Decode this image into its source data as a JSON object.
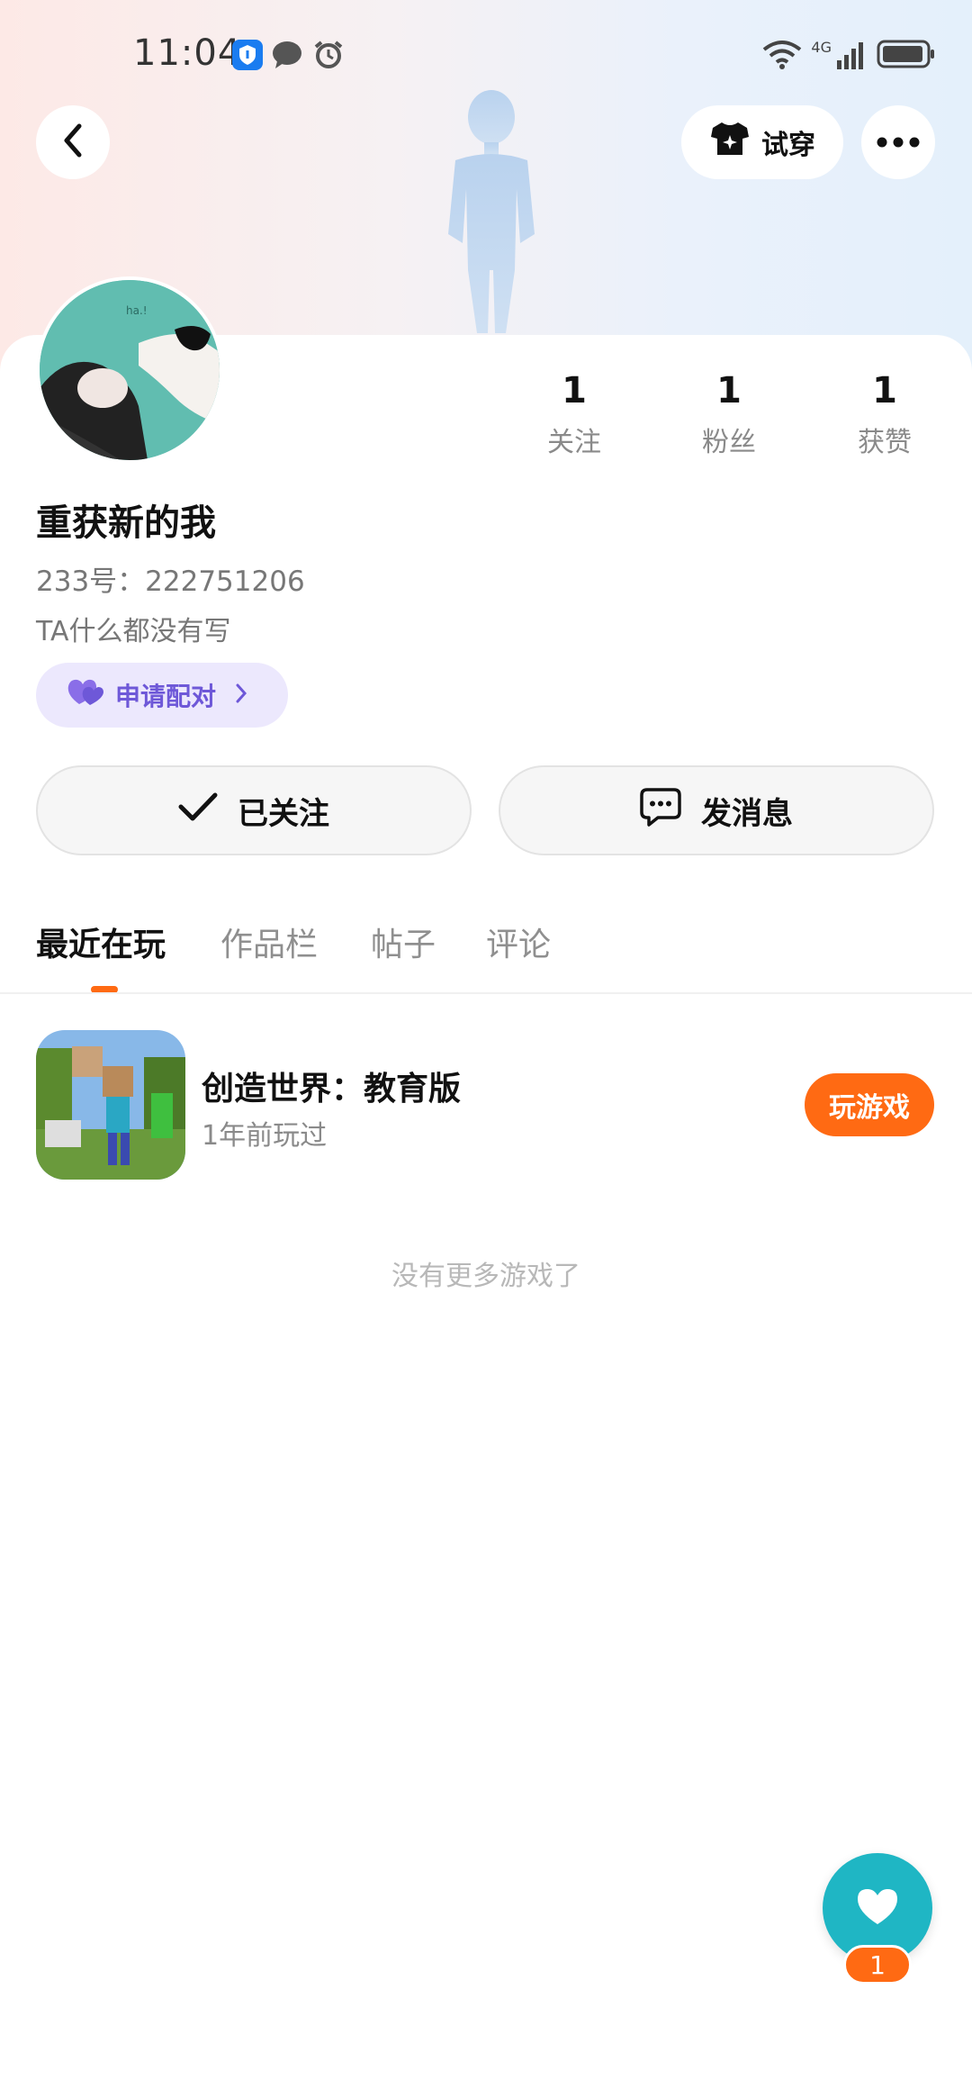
{
  "status_bar": {
    "time": "11:04",
    "icons": [
      "shield-icon",
      "message-bubble-icon",
      "alarm-icon",
      "wifi-icon",
      "signal-icon",
      "battery-icon"
    ],
    "network_label": "4G"
  },
  "header": {
    "back_icon": "chevron-left-icon",
    "tryon_label": "试穿",
    "tryon_icon": "tshirt-sparkle-icon",
    "more_icon": "more-dots-icon"
  },
  "profile": {
    "nickname": "重获新的我",
    "uid": "233号：222751206",
    "bio": "TA什么都没有写",
    "pair_label": "申请配对",
    "stats": [
      {
        "value": "1",
        "label": "关注"
      },
      {
        "value": "1",
        "label": "粉丝"
      },
      {
        "value": "1",
        "label": "获赞"
      }
    ]
  },
  "actions": {
    "follow_label": "已关注",
    "message_label": "发消息"
  },
  "tabs": [
    {
      "label": "最近在玩",
      "active": true
    },
    {
      "label": "作品栏",
      "active": false
    },
    {
      "label": "帖子",
      "active": false
    },
    {
      "label": "评论",
      "active": false
    }
  ],
  "games": [
    {
      "title": "创造世界：教育版",
      "subtitle": "1年前玩过",
      "button": "玩游戏"
    }
  ],
  "list_end_text": "没有更多游戏了",
  "fab": {
    "icon": "heart-icon",
    "badge": "1"
  },
  "colors": {
    "accent": "#ff6a13",
    "pair_bg": "#ece8fd",
    "pair_text": "#6e58d8",
    "fab_bg": "#1fb6c4"
  }
}
